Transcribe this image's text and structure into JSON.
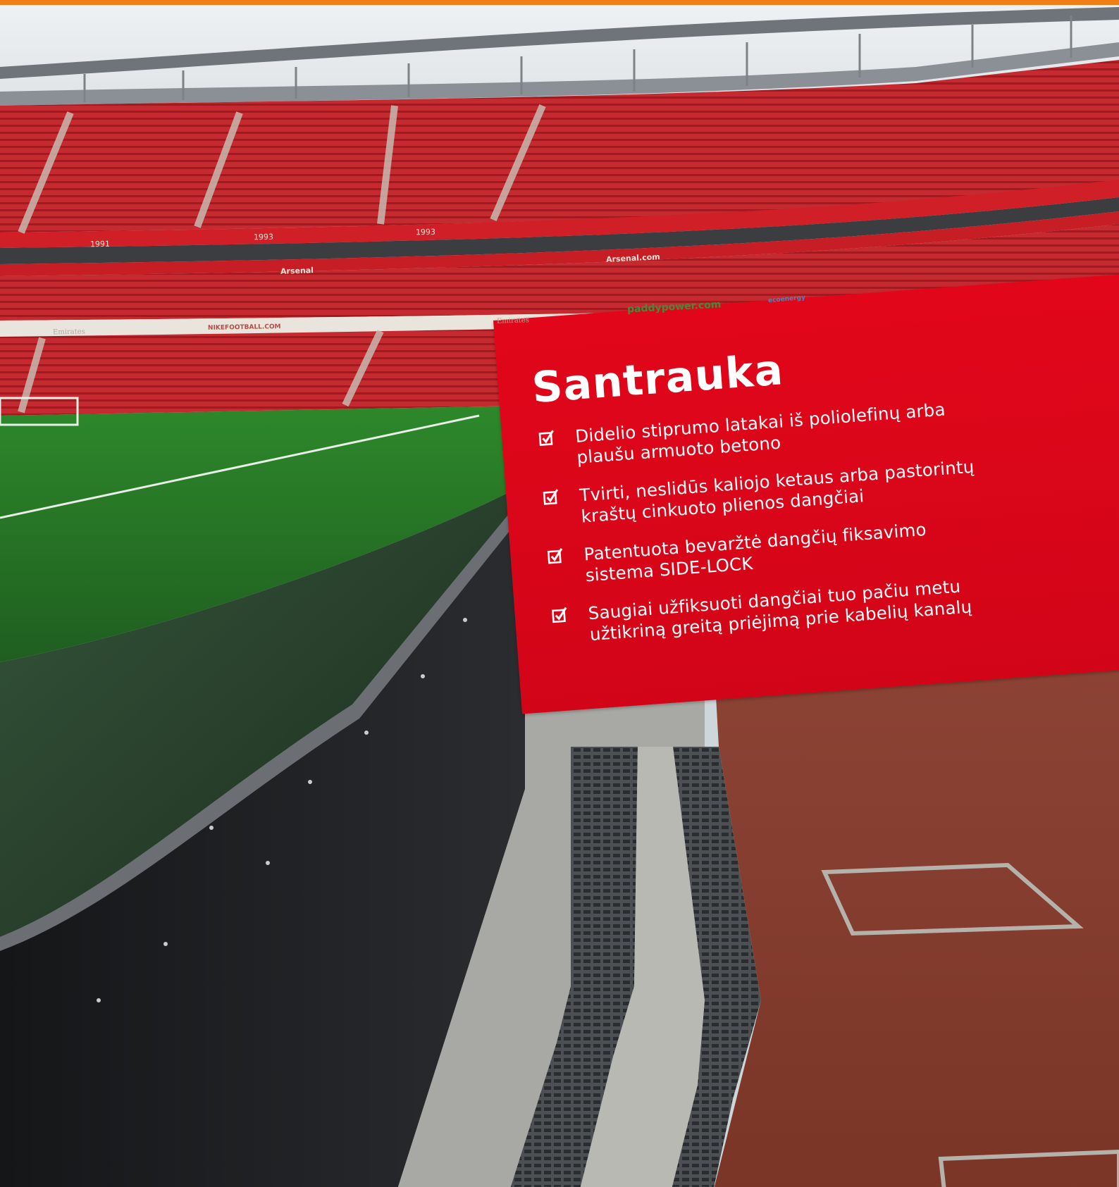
{
  "panel": {
    "title": "Santrauka",
    "accent_color": "#e2061a",
    "items": [
      {
        "icon": "checkbox-checked-icon",
        "text": "Didelio stiprumo latakai iš poliolefinų arba\nplaušu armuoto betono"
      },
      {
        "icon": "checkbox-checked-icon",
        "text": "Tvirti, neslidūs kaliojo ketaus arba pastorintų\nkraštų cinkuoto plienos dangčiai"
      },
      {
        "icon": "checkbox-checked-icon",
        "text": "Patentuota bevaržtė dangčių fiksavimo\nsistema SIDE-LOCK"
      },
      {
        "icon": "checkbox-checked-icon",
        "text": "Saugiai užfiksuoti  dangčiai tuo pačiu metu\nužtikriną greitą priėjimą prie kabelių kanalų"
      }
    ]
  },
  "photo_signage": {
    "year_1": "1991",
    "year_2": "1993",
    "year_3": "1993",
    "sponsor_1": "Arsenal",
    "sponsor_2": "Arsenal.com",
    "sponsor_3": "paddypower.com",
    "sponsor_4": "Emirates",
    "sponsor_5": "Emirates",
    "sponsor_6": "NIKEFOOTBALL.COM",
    "sponsor_7": "ecoenergy"
  },
  "colors": {
    "top_bar": "#f07d16",
    "seats": "#c8202a",
    "grass": "#2f7a2c",
    "track": "#8a3e2e"
  }
}
